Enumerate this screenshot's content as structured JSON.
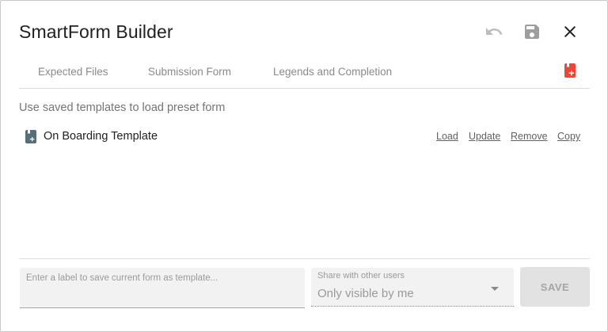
{
  "dialog": {
    "title": "SmartForm Builder",
    "header_icons": [
      "undo-icon",
      "save-icon",
      "close-icon"
    ]
  },
  "tabs": [
    {
      "label": "Expected Files"
    },
    {
      "label": "Submission Form"
    },
    {
      "label": "Legends and Completion"
    }
  ],
  "tab_action_icon": "template-add-icon",
  "accent_color": "#f44336",
  "templates": {
    "hint": "Use saved templates to load preset form",
    "items": [
      {
        "icon": "template-icon",
        "name": "On Boarding Template",
        "actions": {
          "load": "Load",
          "update": "Update",
          "remove": "Remove",
          "copy": "Copy"
        }
      }
    ]
  },
  "footer": {
    "label_input": {
      "value": "",
      "placeholder": "Enter a label to save current form as template..."
    },
    "share": {
      "label": "Share with other users",
      "value": "Only visible by me"
    },
    "save_label": "SAVE"
  }
}
